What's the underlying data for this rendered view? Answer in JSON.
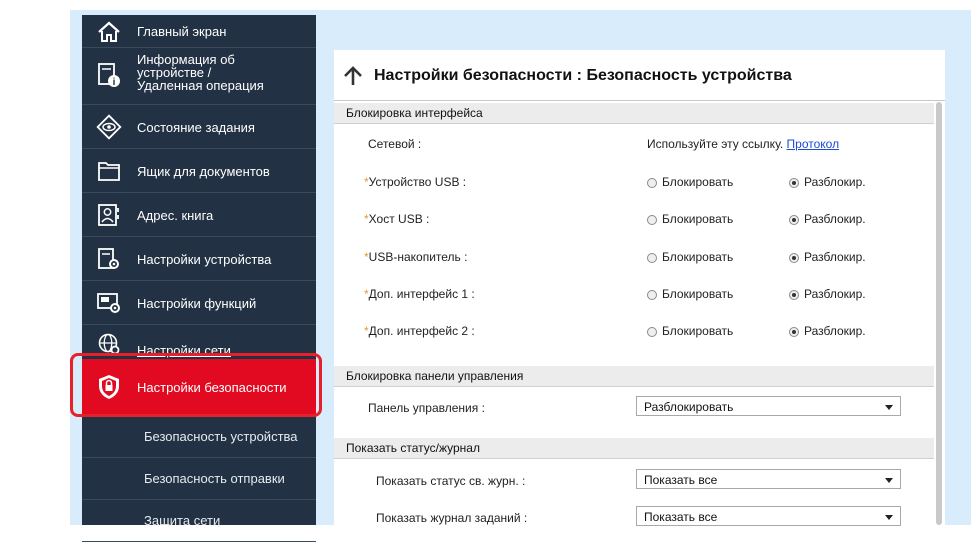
{
  "sidebar": {
    "items": [
      {
        "label": "Главный экран",
        "icon": "home-icon"
      },
      {
        "label": "Информация об устройстве / Удаленная операция",
        "lines": [
          "Информация об",
          "устройстве /",
          "Удаленная операция"
        ],
        "icon": "device-info-icon"
      },
      {
        "label": "Состояние задания",
        "icon": "eye-icon"
      },
      {
        "label": "Ящик для документов",
        "icon": "folder-icon"
      },
      {
        "label": "Адрес. книга",
        "icon": "address-book-icon"
      },
      {
        "label": "Настройки устройства",
        "icon": "device-settings-icon"
      },
      {
        "label": "Настройки функций",
        "icon": "function-settings-icon"
      },
      {
        "label": "Настройки сети",
        "icon": "globe-icon"
      },
      {
        "label": "Настройки безопасности",
        "icon": "shield-lock-icon",
        "active": true
      }
    ],
    "subitems": [
      {
        "label": "Безопасность устройства"
      },
      {
        "label": "Безопасность отправки"
      },
      {
        "label": "Защита сети"
      }
    ],
    "active_color": "#e20a21",
    "highlight_color": "#e8202a"
  },
  "main": {
    "title": "Настройки безопасности : Безопасность устройства",
    "interface_lock": {
      "section": "Блокировка интерфейса",
      "network": {
        "label": "Сетевой :",
        "text": "Используйте эту ссылку.",
        "link": "Протокол"
      },
      "rows": [
        {
          "label": "Устройство USB :",
          "lock": "Блокировать",
          "unlock": "Разблокир.",
          "selected": "unlock"
        },
        {
          "label": "Хост USB :",
          "lock": "Блокировать",
          "unlock": "Разблокир.",
          "selected": "unlock"
        },
        {
          "label": "USB-накопитель :",
          "lock": "Блокировать",
          "unlock": "Разблокир.",
          "selected": "unlock"
        },
        {
          "label": "Доп. интерфейс 1 :",
          "lock": "Блокировать",
          "unlock": "Разблокир.",
          "selected": "unlock"
        },
        {
          "label": "Доп. интерфейс 2 :",
          "lock": "Блокировать",
          "unlock": "Разблокир.",
          "selected": "unlock"
        }
      ],
      "required_mark": "*"
    },
    "panel_lock": {
      "section": "Блокировка панели управления",
      "label": "Панель управления :",
      "value": "Разблокировать"
    },
    "status_log": {
      "section": "Показать статус/журнал",
      "rows": [
        {
          "label": "Показать статус св. журн. :",
          "value": "Показать все"
        },
        {
          "label": "Показать журнал заданий :",
          "value": "Показать все"
        }
      ]
    }
  }
}
